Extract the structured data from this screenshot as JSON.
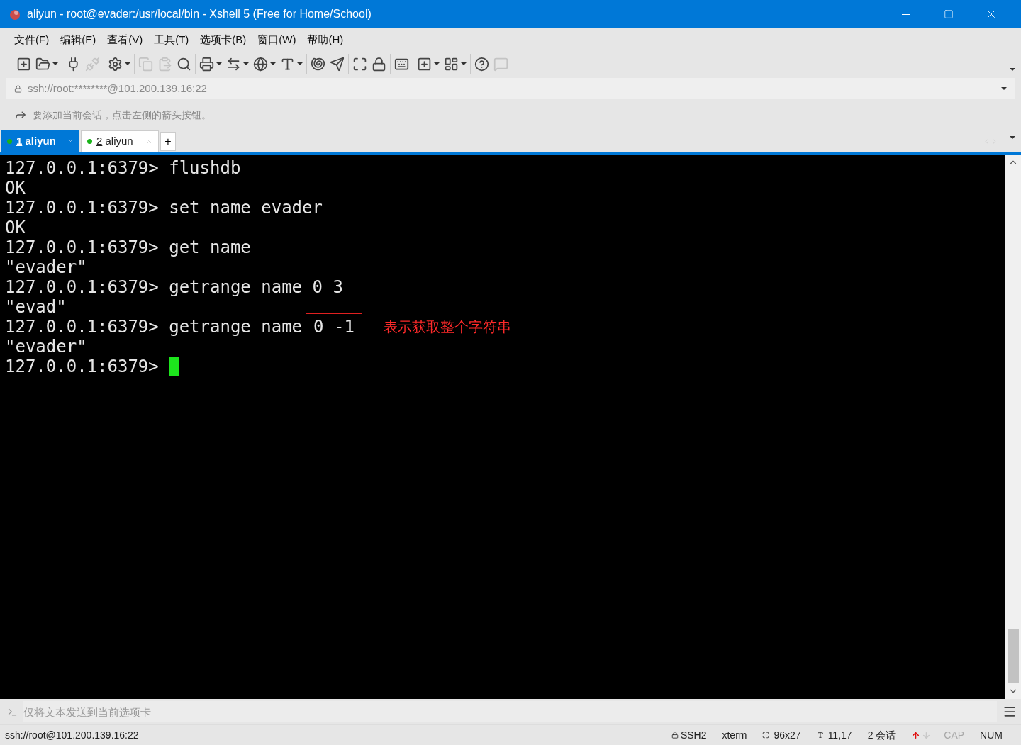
{
  "window": {
    "title": "aliyun - root@evader:/usr/local/bin - Xshell 5 (Free for Home/School)"
  },
  "menu": [
    "文件(F)",
    "编辑(E)",
    "查看(V)",
    "工具(T)",
    "选项卡(B)",
    "窗口(W)",
    "帮助(H)"
  ],
  "toolbar": [
    [
      {
        "kind": "new",
        "dropdown": false,
        "disabled": false
      },
      {
        "kind": "open",
        "dropdown": true,
        "disabled": false
      }
    ],
    [
      {
        "kind": "connect",
        "dropdown": false,
        "disabled": false
      },
      {
        "kind": "disconnect",
        "dropdown": false,
        "disabled": true
      }
    ],
    [
      {
        "kind": "properties",
        "dropdown": true,
        "disabled": false
      }
    ],
    [
      {
        "kind": "copy",
        "dropdown": false,
        "disabled": true
      },
      {
        "kind": "paste",
        "dropdown": false,
        "disabled": true
      },
      {
        "kind": "find",
        "dropdown": false,
        "disabled": false
      }
    ],
    [
      {
        "kind": "print",
        "dropdown": true,
        "disabled": false
      },
      {
        "kind": "transfer",
        "dropdown": true,
        "disabled": false
      },
      {
        "kind": "globe",
        "dropdown": true,
        "disabled": false
      },
      {
        "kind": "font",
        "dropdown": true,
        "disabled": false
      }
    ],
    [
      {
        "kind": "script",
        "dropdown": false,
        "disabled": false
      },
      {
        "kind": "ftp",
        "dropdown": false,
        "disabled": false
      }
    ],
    [
      {
        "kind": "fullscreen",
        "dropdown": false,
        "disabled": false
      },
      {
        "kind": "lock",
        "dropdown": false,
        "disabled": false
      }
    ],
    [
      {
        "kind": "keyboard",
        "dropdown": false,
        "disabled": false
      }
    ],
    [
      {
        "kind": "addtab",
        "dropdown": true,
        "disabled": false
      },
      {
        "kind": "layout",
        "dropdown": true,
        "disabled": false
      }
    ],
    [
      {
        "kind": "help",
        "dropdown": false,
        "disabled": false
      },
      {
        "kind": "chat",
        "dropdown": false,
        "disabled": true
      }
    ]
  ],
  "address": {
    "value": "ssh://root:********@101.200.139.16:22"
  },
  "info_bar": {
    "text": "要添加当前会话，点击左侧的箭头按钮。"
  },
  "tabs": [
    {
      "number": "1",
      "label": "aliyun",
      "selected": true
    },
    {
      "number": "2",
      "label": "aliyun",
      "selected": false
    }
  ],
  "new_tab": "+",
  "terminal": {
    "lines": [
      {
        "text": "127.0.0.1:6379> flushdb"
      },
      {
        "text": "OK"
      },
      {
        "text": "127.0.0.1:6379> set name evader"
      },
      {
        "text": "OK"
      },
      {
        "text": "127.0.0.1:6379> get name"
      },
      {
        "text": "\"evader\""
      },
      {
        "text": "127.0.0.1:6379> getrange name 0 3"
      },
      {
        "text": "\"evad\""
      },
      {
        "text": "127.0.0.1:6379> getrange name",
        "boxed": "0 -1",
        "note": "表示获取整个字符串"
      },
      {
        "text": "\"evader\""
      },
      {
        "text": "127.0.0.1:6379>",
        "cursor": true
      }
    ]
  },
  "compose_bar": {
    "placeholder": "仅将文本发送到当前选项卡"
  },
  "status_bar": {
    "connection": "ssh://root@101.200.139.16:22",
    "items": [
      {
        "kind": "lock",
        "text": "SSH2"
      },
      {
        "kind": "plain",
        "text": "xterm"
      },
      {
        "kind": "size",
        "text": "96x27"
      },
      {
        "kind": "cursorpos",
        "text": "11,17"
      },
      {
        "kind": "plain",
        "text": "2 会话"
      },
      {
        "kind": "arrows"
      },
      {
        "kind": "toggle",
        "text": "CAP",
        "on": false
      },
      {
        "kind": "toggle",
        "text": "NUM",
        "on": true
      }
    ]
  }
}
